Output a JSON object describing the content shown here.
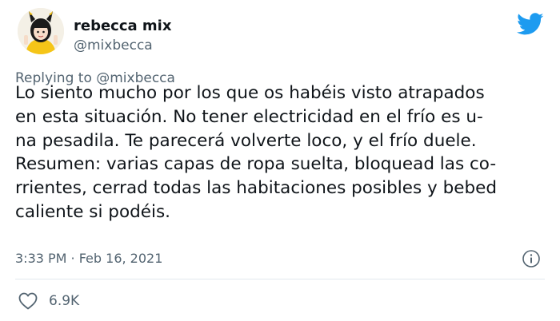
{
  "author": {
    "display_name": "rebecca mix",
    "handle": "@mixbecca",
    "avatar": "avatar-illustration"
  },
  "replying_to": "Replying to @mixbecca",
  "tweet": {
    "lines": [
      "Lo siento mucho por los que os habéis visto atrapados",
      "en esta situación. No tener electricidad en el frío es u-",
      "na pesadila. Te parecerá volverte loco, y el frío duele.",
      "Resumen: varias capas de ropa suelta, bloquead las co-",
      "rrientes, cerrad todas las habitaciones posibles y bebed",
      "caliente si podéis."
    ],
    "timestamp": "3:33 PM · Feb 16, 2021"
  },
  "likes": {
    "count": "6.9K"
  },
  "icons": {
    "brand": "twitter-bird-icon",
    "info": "info-icon",
    "like": "heart-icon"
  },
  "colors": {
    "brand": "#1d9bf0",
    "text": "#0f1419",
    "secondary": "#536471",
    "divider": "#e1e8ed"
  }
}
